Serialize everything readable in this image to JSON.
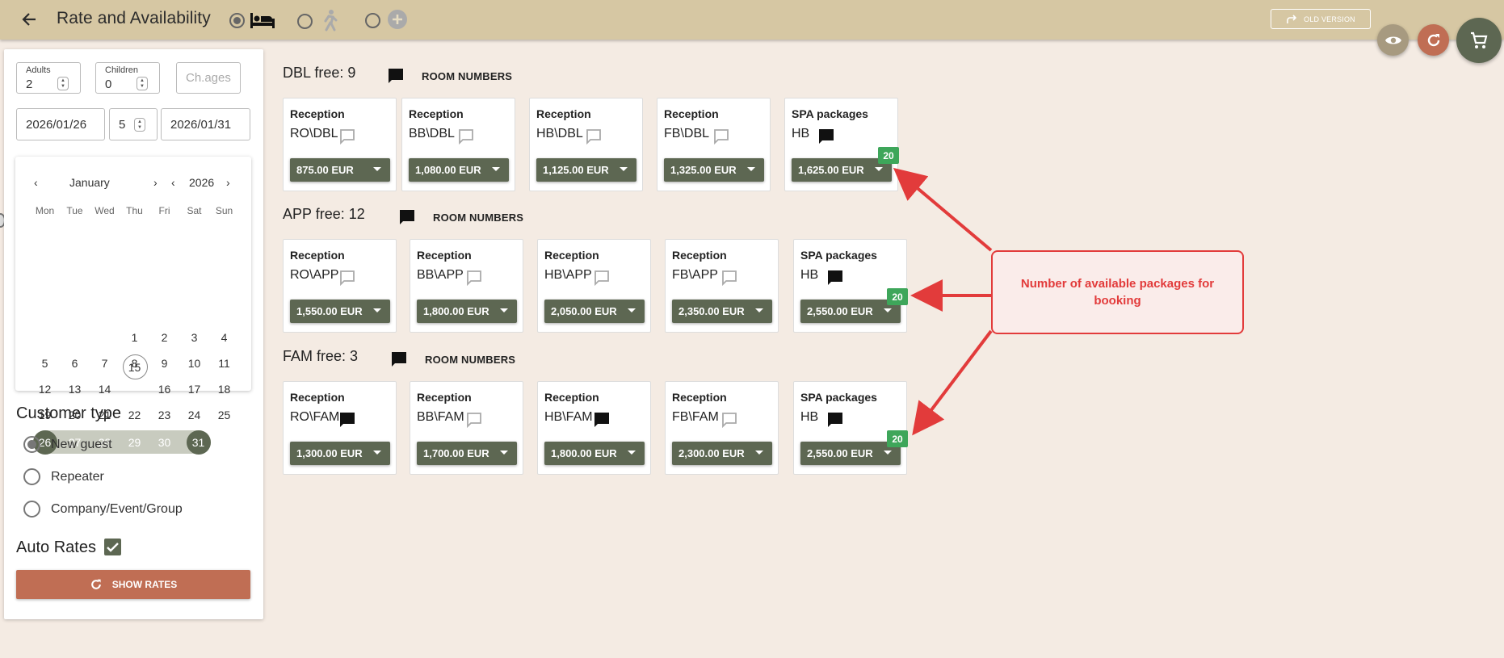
{
  "header": {
    "title": "Rate and Availability",
    "old_version_label": "OLD VERSION"
  },
  "search": {
    "adults_label": "Adults",
    "adults_value": "2",
    "children_label": "Children",
    "children_value": "0",
    "child_ages_placeholder": "Ch.ages",
    "date_from": "2026/01/26",
    "nights": "5",
    "date_to": "2026/01/31"
  },
  "calendar": {
    "month": "January",
    "year": "2026",
    "weekdays": [
      "Mon",
      "Tue",
      "Wed",
      "Thu",
      "Fri",
      "Sat",
      "Sun"
    ],
    "rows": [
      [
        "",
        "",
        "",
        "1",
        "2",
        "3",
        "4"
      ],
      [
        "5",
        "6",
        "7",
        "8",
        "9",
        "10",
        "11"
      ],
      [
        "12",
        "13",
        "14",
        "15",
        "16",
        "17",
        "18"
      ],
      [
        "19",
        "20",
        "21",
        "22",
        "23",
        "24",
        "25"
      ],
      [
        "26",
        "27",
        "28",
        "29",
        "30",
        "31",
        ""
      ]
    ],
    "today": "15",
    "range_start": "26",
    "range_end": "31"
  },
  "customer": {
    "heading": "Customer type",
    "options": [
      "New guest",
      "Repeater",
      "Company/Event/Group"
    ],
    "selected": "New guest"
  },
  "auto_rates": {
    "label": "Auto Rates",
    "checked": true
  },
  "show_rates_label": "SHOW RATES",
  "room_numbers_label": "ROOM NUMBERS",
  "groups": [
    {
      "title": "DBL free: 9",
      "cards": [
        {
          "category": "Reception",
          "code": "RO\\DBL",
          "note": "empty",
          "price": "875.00 EUR"
        },
        {
          "category": "Reception",
          "code": "BB\\DBL",
          "note": "empty",
          "price": "1,080.00 EUR"
        },
        {
          "category": "Reception",
          "code": "HB\\DBL",
          "note": "empty",
          "price": "1,125.00 EUR"
        },
        {
          "category": "Reception",
          "code": "FB\\DBL",
          "note": "empty",
          "price": "1,325.00 EUR"
        },
        {
          "category": "SPA packages",
          "code": "HB",
          "note": "filled",
          "price": "1,625.00 EUR",
          "available": "20"
        }
      ]
    },
    {
      "title": "APP free: 12",
      "cards": [
        {
          "category": "Reception",
          "code": "RO\\APP",
          "note": "empty",
          "price": "1,550.00 EUR"
        },
        {
          "category": "Reception",
          "code": "BB\\APP",
          "note": "empty",
          "price": "1,800.00 EUR"
        },
        {
          "category": "Reception",
          "code": "HB\\APP",
          "note": "empty",
          "price": "2,050.00 EUR"
        },
        {
          "category": "Reception",
          "code": "FB\\APP",
          "note": "empty",
          "price": "2,350.00 EUR"
        },
        {
          "category": "SPA packages",
          "code": "HB",
          "note": "filled",
          "price": "2,550.00 EUR",
          "available": "20"
        }
      ]
    },
    {
      "title": "FAM free: 3",
      "cards": [
        {
          "category": "Reception",
          "code": "RO\\FAM",
          "note": "filled",
          "price": "1,300.00 EUR"
        },
        {
          "category": "Reception",
          "code": "BB\\FAM",
          "note": "empty",
          "price": "1,700.00 EUR"
        },
        {
          "category": "Reception",
          "code": "HB\\FAM",
          "note": "filled",
          "price": "1,800.00 EUR"
        },
        {
          "category": "Reception",
          "code": "FB\\FAM",
          "note": "empty",
          "price": "2,300.00 EUR"
        },
        {
          "category": "SPA packages",
          "code": "HB",
          "note": "filled",
          "price": "2,550.00 EUR",
          "available": "20"
        }
      ]
    }
  ],
  "annotation": {
    "text": "Number of available packages for booking"
  },
  "colors": {
    "header": "#d6c7a3",
    "background": "#f4ebe3",
    "accent_green": "#5d6752",
    "availability_badge": "#3ea65a",
    "show_rates": "#c06e54",
    "annotation_red": "#e23b3b"
  },
  "icons": {
    "header": [
      "back-arrow-icon",
      "bed-icon",
      "walking-person-icon",
      "add-circle-icon",
      "forward-arrow-icon",
      "eye-icon",
      "refresh-icon",
      "cart-icon"
    ],
    "cards": [
      "comment-icon"
    ]
  }
}
